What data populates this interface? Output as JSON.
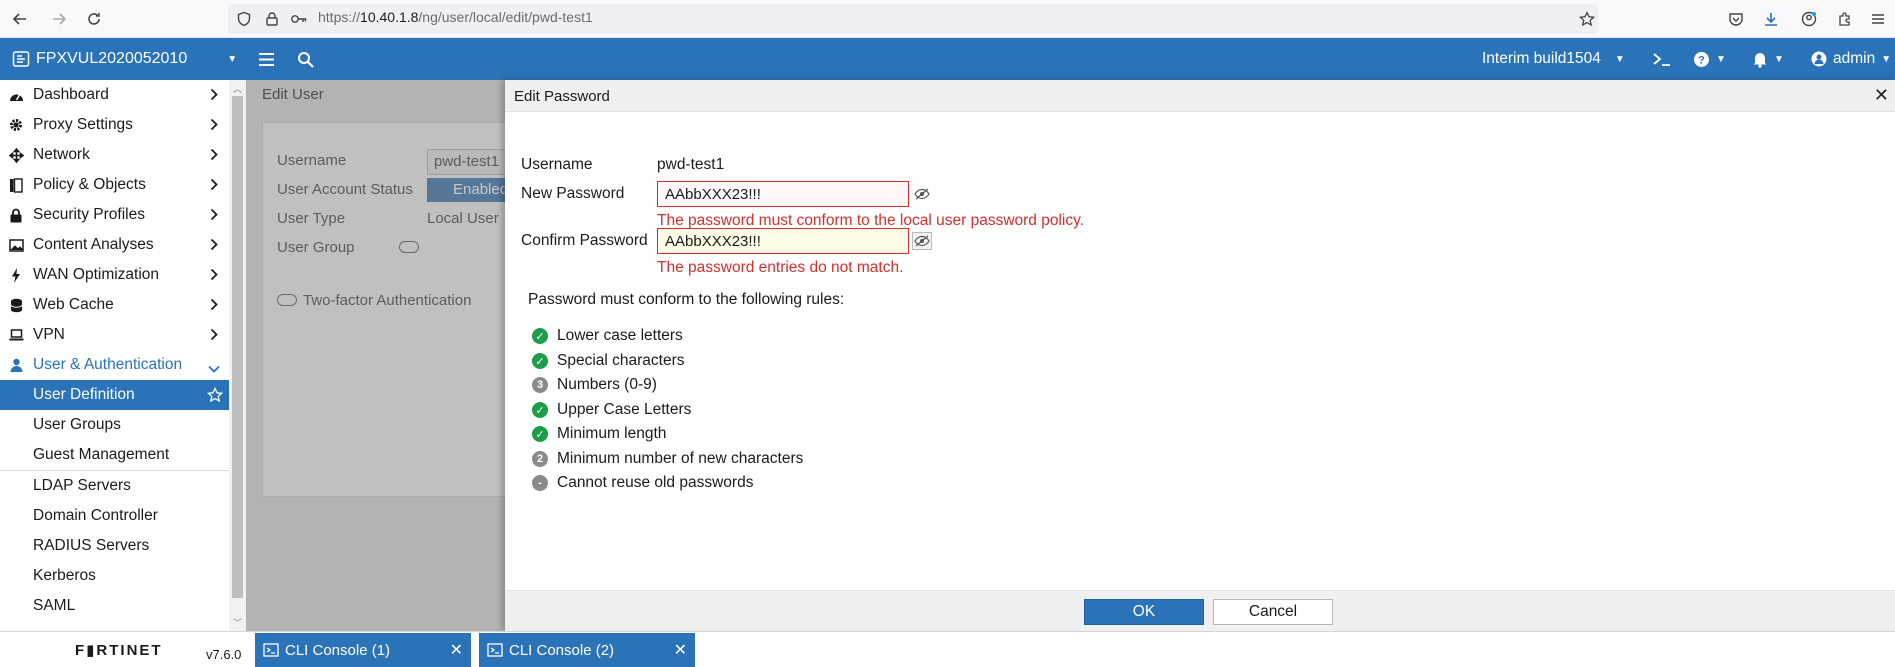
{
  "browser": {
    "url_prefix": "https://",
    "url_host": "10.40.1.8",
    "url_path": "/ng/user/local/edit/pwd-test1"
  },
  "header": {
    "device_name": "FPXVUL2020052010",
    "build": "Interim build1504",
    "user": "admin"
  },
  "sidebar": {
    "items": [
      {
        "label": "Dashboard",
        "icon": "dashboard-icon"
      },
      {
        "label": "Proxy Settings",
        "icon": "gear-icon"
      },
      {
        "label": "Network",
        "icon": "network-icon"
      },
      {
        "label": "Policy & Objects",
        "icon": "policy-icon"
      },
      {
        "label": "Security Profiles",
        "icon": "lock-icon"
      },
      {
        "label": "Content Analyses",
        "icon": "image-icon"
      },
      {
        "label": "WAN Optimization",
        "icon": "bolt-icon"
      },
      {
        "label": "Web Cache",
        "icon": "database-icon"
      },
      {
        "label": "VPN",
        "icon": "laptop-icon"
      },
      {
        "label": "User & Authentication",
        "icon": "user-icon"
      }
    ],
    "subitems": [
      "User Definition",
      "User Groups",
      "Guest Management",
      "LDAP Servers",
      "Domain Controller",
      "RADIUS Servers",
      "Kerberos",
      "SAML"
    ]
  },
  "background_form": {
    "title": "Edit User",
    "username_label": "Username",
    "username_value": "pwd-test1",
    "status_label": "User Account Status",
    "status_value": "Enabled",
    "type_label": "User Type",
    "type_value": "Local User",
    "group_label": "User Group",
    "twofactor_label": "Two-factor Authentication"
  },
  "modal": {
    "title": "Edit Password",
    "username_label": "Username",
    "username_value": "pwd-test1",
    "new_password_label": "New Password",
    "new_password_value": "AAbbXXX23!!!",
    "new_password_error": "The password must conform to the local user password policy.",
    "confirm_password_label": "Confirm Password",
    "confirm_password_value": "AAbbXXX23!!!",
    "confirm_password_error": "The password entries do not match.",
    "rules_heading": "Password must conform to the following rules:",
    "rules": [
      {
        "badge": "ok",
        "badge_text": "",
        "label": "Lower case letters"
      },
      {
        "badge": "ok",
        "badge_text": "",
        "label": "Special characters"
      },
      {
        "badge": "num",
        "badge_text": "3",
        "label": "Numbers (0-9)"
      },
      {
        "badge": "ok",
        "badge_text": "",
        "label": "Upper Case Letters"
      },
      {
        "badge": "ok",
        "badge_text": "",
        "label": "Minimum length"
      },
      {
        "badge": "num",
        "badge_text": "2",
        "label": "Minimum number of new characters"
      },
      {
        "badge": "num",
        "badge_text": "-",
        "label": "Cannot reuse old passwords"
      }
    ],
    "ok_label": "OK",
    "cancel_label": "Cancel"
  },
  "footer": {
    "logo": "F▮RTINET",
    "version": "v7.6.0",
    "tabs": [
      "CLI Console (1)",
      "CLI Console (2)"
    ]
  },
  "colors": {
    "brand_blue": "#2a73b8",
    "error_red": "#d0312d",
    "rule_ok_green": "#1d9e4a",
    "rule_num_gray": "#8a8a8a"
  }
}
